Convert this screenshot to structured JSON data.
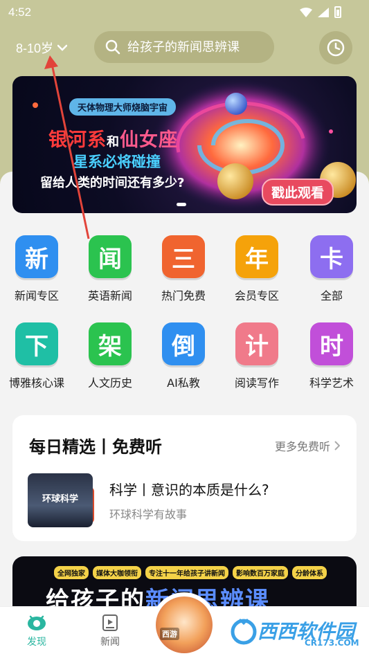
{
  "status": {
    "time": "4:52"
  },
  "header": {
    "age_label": "8-10岁",
    "search_placeholder": "给孩子的新闻思辨课"
  },
  "banner": {
    "tag": "天体物理大师烧脑宇宙",
    "line1_a": "银河系",
    "line1_b": "和",
    "line1_c": "仙女座",
    "line2": "星系必将碰撞",
    "line3": "留给人类的时间还有多少?",
    "cta": "戳此观看"
  },
  "categories": [
    {
      "glyph": "新",
      "label": "新闻专区",
      "color": "#2f8ff0"
    },
    {
      "glyph": "闻",
      "label": "英语新闻",
      "color": "#2bc34f"
    },
    {
      "glyph": "三",
      "label": "热门免费",
      "color": "#f0642f"
    },
    {
      "glyph": "年",
      "label": "会员专区",
      "color": "#f5a20a"
    },
    {
      "glyph": "卡",
      "label": "全部",
      "color": "#8d6ef0"
    },
    {
      "glyph": "下",
      "label": "博雅核心课",
      "color": "#1fbfa5"
    },
    {
      "glyph": "架",
      "label": "人文历史",
      "color": "#2bc34f"
    },
    {
      "glyph": "倒",
      "label": "AI私教",
      "color": "#2f8ff0"
    },
    {
      "glyph": "计",
      "label": "阅读写作",
      "color": "#f07a8a"
    },
    {
      "glyph": "时",
      "label": "科学艺术",
      "color": "#c14fd9"
    }
  ],
  "daily": {
    "title": "每日精选丨免费听",
    "more": "更多免费听",
    "thumb_text": "环球科学",
    "item_title": "科学丨意识的本质是什么?",
    "item_sub": "环球科学有故事"
  },
  "promo": {
    "tags": [
      "全网独家",
      "媒体大咖领衔",
      "专注十一年给孩子讲新闻",
      "影响数百万家庭",
      "分龄体系"
    ],
    "headline_a": "给孩子的",
    "headline_b": "新闻思辨课"
  },
  "tabbar": {
    "tabs": [
      {
        "label": "发现"
      },
      {
        "label": "新闻"
      }
    ],
    "center_label": "西游"
  },
  "watermark": {
    "text": "西西软件园",
    "sub": "CR173.COM"
  }
}
